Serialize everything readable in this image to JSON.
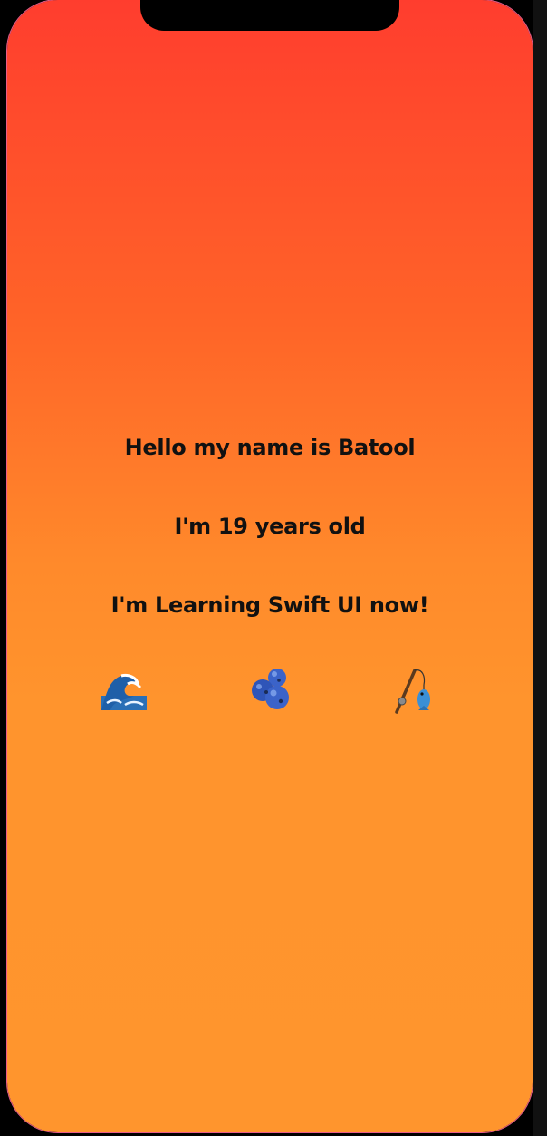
{
  "texts": {
    "line1": "Hello my name is Batool",
    "line2": "I'm 19 years old",
    "line3": "I'm Learning Swift UI now!"
  },
  "icons": [
    {
      "name": "wave-emoji",
      "glyph": "🌊"
    },
    {
      "name": "blueberries-emoji",
      "glyph": "🫐"
    },
    {
      "name": "fishing-pole-emoji",
      "glyph": "🎣"
    }
  ],
  "colors": {
    "gradient_top": "#ff3d2e",
    "gradient_bottom": "#ff952d",
    "text": "#111111"
  }
}
